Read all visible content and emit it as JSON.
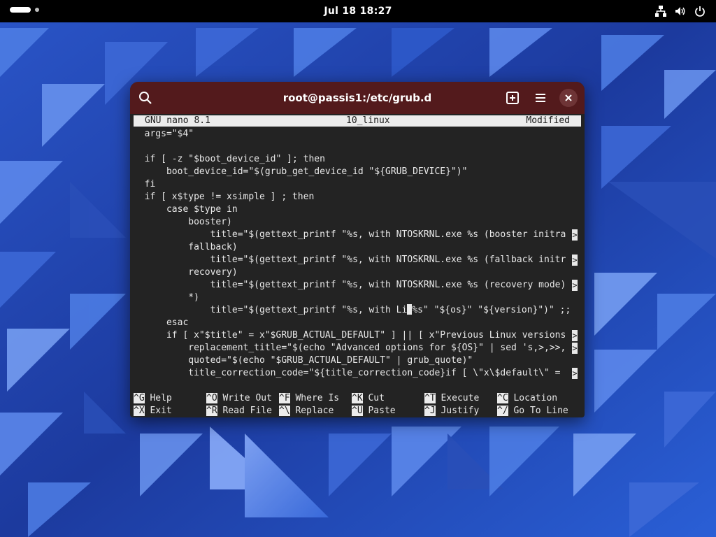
{
  "topbar": {
    "clock": "Jul 18  18:27",
    "tray_icons": [
      "network-icon",
      "volume-icon",
      "power-icon"
    ]
  },
  "window": {
    "title": "root@passis1:/etc/grub.d",
    "buttons": [
      "search-icon",
      "new-tab-icon",
      "menu-icon",
      "close-icon"
    ]
  },
  "nano": {
    "version": "GNU nano 8.1",
    "filename": "10_linux",
    "status": "Modified",
    "lines": [
      {
        "text": "  args=\"$4\"",
        "truncated": false
      },
      {
        "text": "",
        "truncated": false
      },
      {
        "text": "  if [ -z \"$boot_device_id\" ]; then",
        "truncated": false
      },
      {
        "text": "      boot_device_id=\"$(grub_get_device_id \"${GRUB_DEVICE}\")\"",
        "truncated": false
      },
      {
        "text": "  fi",
        "truncated": false
      },
      {
        "text": "  if [ x$type != xsimple ] ; then",
        "truncated": false
      },
      {
        "text": "      case $type in",
        "truncated": false
      },
      {
        "text": "          booster)",
        "truncated": false
      },
      {
        "text": "              title=\"$(gettext_printf \"%s, with NTOSKRNL.exe %s (booster initra",
        "truncated": true
      },
      {
        "text": "          fallback)",
        "truncated": false
      },
      {
        "text": "              title=\"$(gettext_printf \"%s, with NTOSKRNL.exe %s (fallback initr",
        "truncated": true
      },
      {
        "text": "          recovery)",
        "truncated": false
      },
      {
        "text": "              title=\"$(gettext_printf \"%s, with NTOSKRNL.exe %s (recovery mode)",
        "truncated": true
      },
      {
        "text": "          *)",
        "truncated": false
      },
      {
        "text": "              title=\"$(gettext_printf \"%s, with Li",
        "cursor_after": "%s\" \"${os}\" \"${version}\")\" ;;",
        "truncated": false
      },
      {
        "text": "      esac",
        "truncated": false
      },
      {
        "text": "      if [ x\"$title\" = x\"$GRUB_ACTUAL_DEFAULT\" ] || [ x\"Previous Linux versions",
        "truncated": true
      },
      {
        "text": "          replacement_title=\"$(echo \"Advanced options for ${OS}\" | sed 's,>,>>,",
        "truncated": true
      },
      {
        "text": "          quoted=\"$(echo \"$GRUB_ACTUAL_DEFAULT\" | grub_quote)\"",
        "truncated": false
      },
      {
        "text": "          title_correction_code=\"${title_correction_code}if [ \\\"x\\$default\\\" = ",
        "truncated": true
      }
    ],
    "truncation_marker": ">",
    "shortcuts_row1": [
      {
        "key": "^G",
        "label": "Help"
      },
      {
        "key": "^O",
        "label": "Write Out"
      },
      {
        "key": "^F",
        "label": "Where Is"
      },
      {
        "key": "^K",
        "label": "Cut"
      },
      {
        "key": "^T",
        "label": "Execute"
      },
      {
        "key": "^C",
        "label": "Location"
      }
    ],
    "shortcuts_row2": [
      {
        "key": "^X",
        "label": "Exit"
      },
      {
        "key": "^R",
        "label": "Read File"
      },
      {
        "key": "^\\",
        "label": "Replace"
      },
      {
        "key": "^U",
        "label": "Paste"
      },
      {
        "key": "^J",
        "label": "Justify"
      },
      {
        "key": "^/",
        "label": "Go To Line"
      }
    ]
  },
  "colors": {
    "headerbar": "#531a1c",
    "terminal_bg": "#232323",
    "wallpaper_base": "#1f3fa6"
  }
}
